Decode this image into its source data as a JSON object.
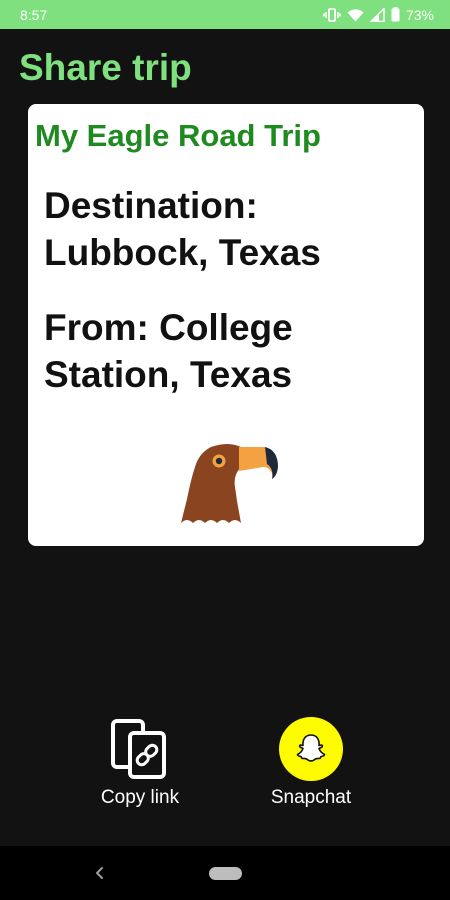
{
  "status_bar": {
    "time": "8:57",
    "battery": "73%",
    "icons": [
      "vibrate-icon",
      "wifi-icon",
      "signal-icon",
      "battery-icon"
    ]
  },
  "header": {
    "title": "Share trip"
  },
  "card": {
    "title": "My Eagle Road Trip",
    "destination": "Destination: Lubbock, Texas",
    "origin": "From: College Station, Texas",
    "image": "eagle-icon"
  },
  "share_options": [
    {
      "label": "Copy link",
      "icon": "copy-link-icon"
    },
    {
      "label": "Snapchat",
      "icon": "snapchat-ghost-icon"
    }
  ],
  "navigation": {
    "icons": [
      "back-icon",
      "home-pill"
    ]
  },
  "colors": {
    "accent_green": "#7ee07e",
    "card_title_green": "#1f8a1f",
    "background": "#121212",
    "snapchat_yellow": "#fffc00",
    "eagle_brown": "#8a4420",
    "beak_orange": "#f4a142"
  }
}
